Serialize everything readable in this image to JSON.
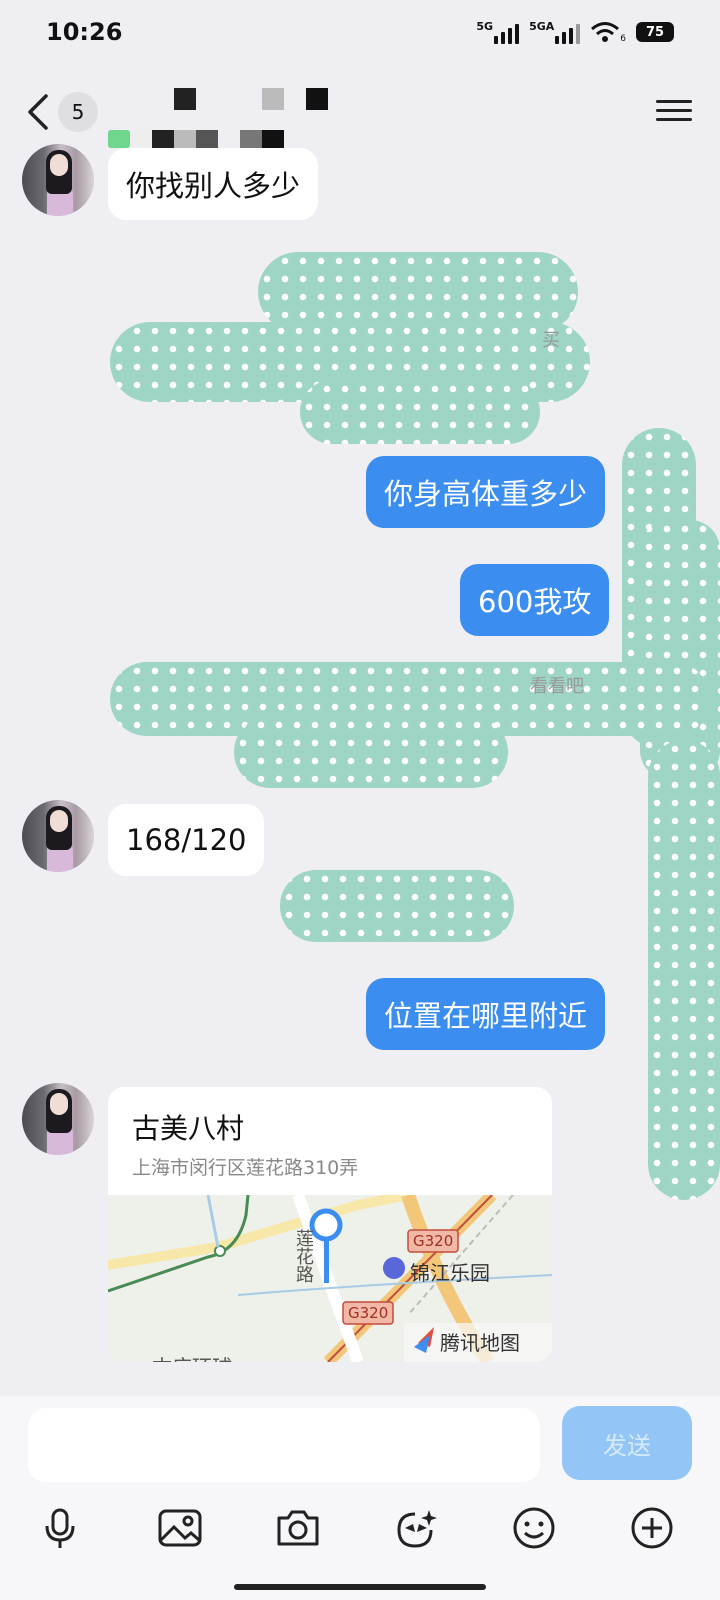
{
  "status_bar": {
    "time": "10:26",
    "signal1_label": "5G",
    "signal2_label": "5GA",
    "wifi_sub": "6",
    "battery": "75"
  },
  "header": {
    "unread_count": "5"
  },
  "messages": [
    {
      "side": "in",
      "text": "你找别人多少"
    },
    {
      "side": "out",
      "text": "你身高体重多少"
    },
    {
      "side": "out",
      "text": "600我攻"
    },
    {
      "side": "in",
      "text": "168/120"
    },
    {
      "side": "out",
      "text": "位置在哪里附近"
    }
  ],
  "partial_text": {
    "fragment1": "买",
    "fragment2": "看看吧"
  },
  "location_card": {
    "name": "古美八村",
    "address": "上海市闵行区莲花路310弄",
    "map_labels": {
      "road": "莲花路",
      "highway1": "G320",
      "highway2": "G320",
      "poi": "锦江乐园",
      "provider": "腾讯地图",
      "cut_label": "古庙环球"
    }
  },
  "composer": {
    "input_value": "",
    "send_label": "发送"
  },
  "toolbar_icons": [
    "microphone-icon",
    "image-icon",
    "camera-icon",
    "sticker-icon",
    "emoji-icon",
    "plus-icon"
  ],
  "colors": {
    "background": "#efeff3",
    "bubble_out": "#3b8ef0",
    "bubble_in": "#ffffff",
    "censor": "#9ed5c7",
    "send_disabled": "#93c6f6"
  }
}
